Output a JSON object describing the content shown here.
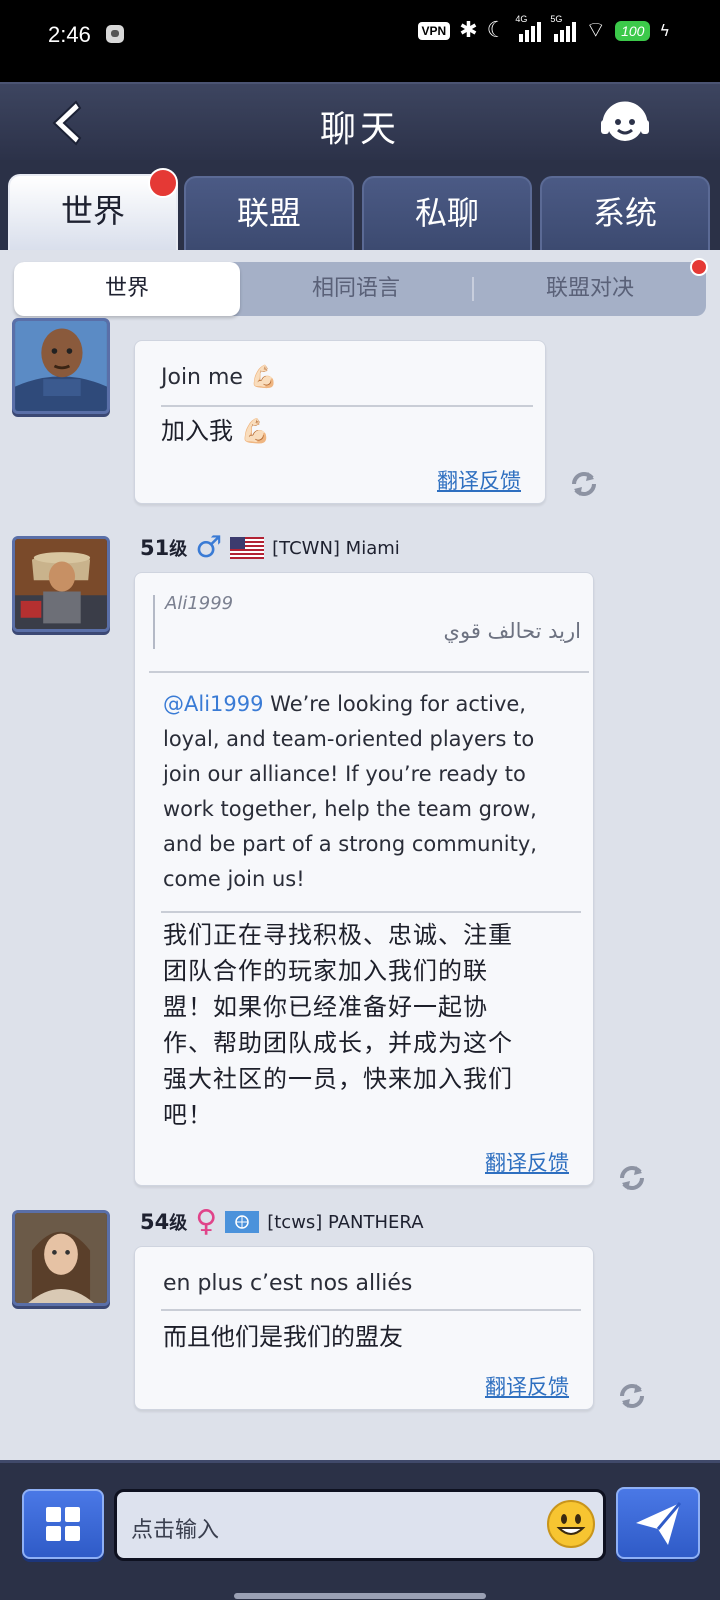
{
  "status_bar": {
    "time": "2:46",
    "vpn": "VPN",
    "net1": "4G",
    "net2": "5G",
    "battery": "100"
  },
  "header": {
    "title": "聊天"
  },
  "tabs": [
    {
      "label": "世界",
      "active": true,
      "badge": true
    },
    {
      "label": "联盟"
    },
    {
      "label": "私聊"
    },
    {
      "label": "系统"
    }
  ],
  "subtabs": [
    {
      "label": "世界",
      "active": true
    },
    {
      "label": "相同语言"
    },
    {
      "label": "联盟对决",
      "badge": true
    }
  ],
  "messages": [
    {
      "original": "Join me 💪🏻",
      "translation": "加入我 💪🏻",
      "feedback": "翻译反馈"
    },
    {
      "level": "51",
      "level_unit": "级",
      "gender": "♂",
      "name": "[TCWN] Miami",
      "quote_user": "Ali1999",
      "quote_text": "اريد تحالف قوي",
      "mention": "@Ali1999",
      "original_lines": [
        "We’re looking for active,",
        "loyal, and team-oriented players to",
        "join our alliance! If you’re ready to",
        "work together, help the team grow,",
        "and be part of a strong community,",
        "come join us!"
      ],
      "translation_lines": [
        "我们正在寻找积极、忠诚、注重",
        "团队合作的玩家加入我们的联",
        "盟！如果你已经准备好一起协",
        "作、帮助团队成长，并成为这个",
        "强大社区的一员，快来加入我们",
        "吧！"
      ],
      "feedback": "翻译反馈"
    },
    {
      "level": "54",
      "level_unit": "级",
      "gender": "♀",
      "name": "[tcws] PANTHERA",
      "original": "en plus c’est nos alliés",
      "translation": "而且他们是我们的盟友",
      "feedback": "翻译反馈"
    }
  ],
  "input": {
    "placeholder": "点击输入"
  },
  "colors": {
    "accent_blue": "#2f5bc7",
    "badge_red": "#e53935",
    "link_blue": "#2e6fc0"
  }
}
